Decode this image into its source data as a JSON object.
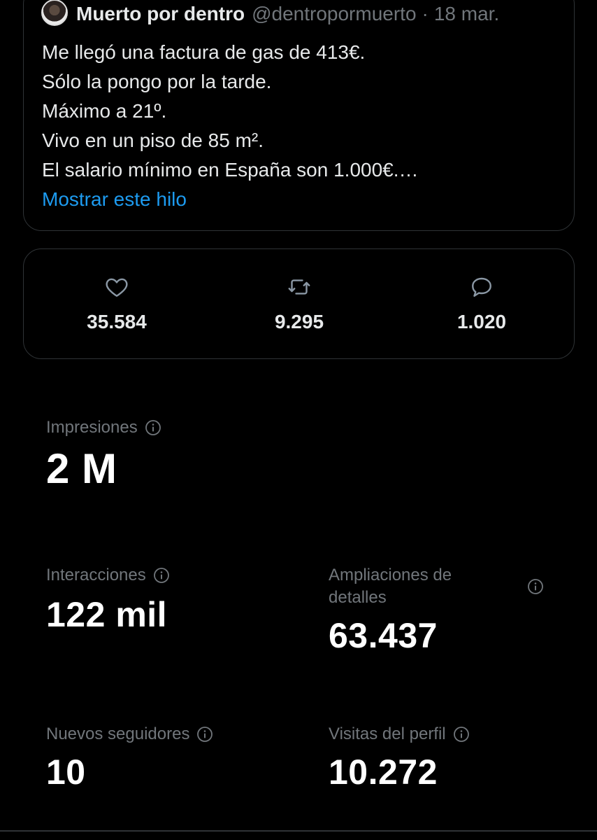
{
  "tweet": {
    "author_name": "Muerto por dentro",
    "author_handle": "@dentropormuerto",
    "separator": "·",
    "date": "18 mar.",
    "lines": [
      "Me llegó una factura de gas de 413€.",
      "Sólo la pongo por la tarde.",
      "Máximo a 21º.",
      "Vivo en un piso de 85 m².",
      "El salario mínimo en España son 1.000€.…"
    ],
    "thread_link": "Mostrar este hilo"
  },
  "engagement": {
    "likes": {
      "icon": "heart-icon",
      "count": "35.584"
    },
    "retweets": {
      "icon": "retweet-icon",
      "count": "9.295"
    },
    "replies": {
      "icon": "reply-icon",
      "count": "1.020"
    }
  },
  "metrics": {
    "impressions": {
      "label": "Impresiones",
      "value": "2 M"
    },
    "interactions": {
      "label": "Interacciones",
      "value": "122 mil"
    },
    "detail_expands": {
      "label_line1": "Ampliaciones de",
      "label_line2": "detalles",
      "value": "63.437"
    },
    "new_followers": {
      "label": "Nuevos seguidores",
      "value": "10"
    },
    "profile_visits": {
      "label": "Visitas del perfil",
      "value": "10.272"
    }
  },
  "colors": {
    "background": "#000000",
    "text": "#e7e9ea",
    "muted": "#71767b",
    "link": "#1d9bf0",
    "border": "#2f3336"
  }
}
